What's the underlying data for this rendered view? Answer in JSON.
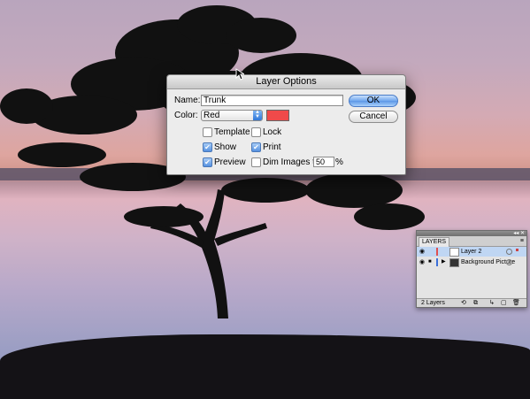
{
  "dialog": {
    "title": "Layer Options",
    "name_label": "Name:",
    "name_value": "Trunk",
    "color_label": "Color:",
    "color_value": "Red",
    "swatch_color": "#f04a4a",
    "ok_label": "OK",
    "cancel_label": "Cancel",
    "template_label": "Template",
    "template_checked": false,
    "lock_label": "Lock",
    "lock_checked": false,
    "show_label": "Show",
    "show_checked": true,
    "print_label": "Print",
    "print_checked": true,
    "preview_label": "Preview",
    "preview_checked": true,
    "dim_label": "Dim Images to:",
    "dim_checked": false,
    "dim_value": "50",
    "dim_unit": "%"
  },
  "layers_panel": {
    "tab_label": "LAYERS",
    "rows": [
      {
        "name": "Layer 2",
        "selected": true,
        "color": "#e05050"
      },
      {
        "name": "Background Picture",
        "selected": false,
        "color": "#3b6fd9"
      }
    ],
    "count_label": "2 Layers"
  },
  "icons": {
    "checkmark": "✔",
    "eye": "👁",
    "triangle": "▶"
  }
}
